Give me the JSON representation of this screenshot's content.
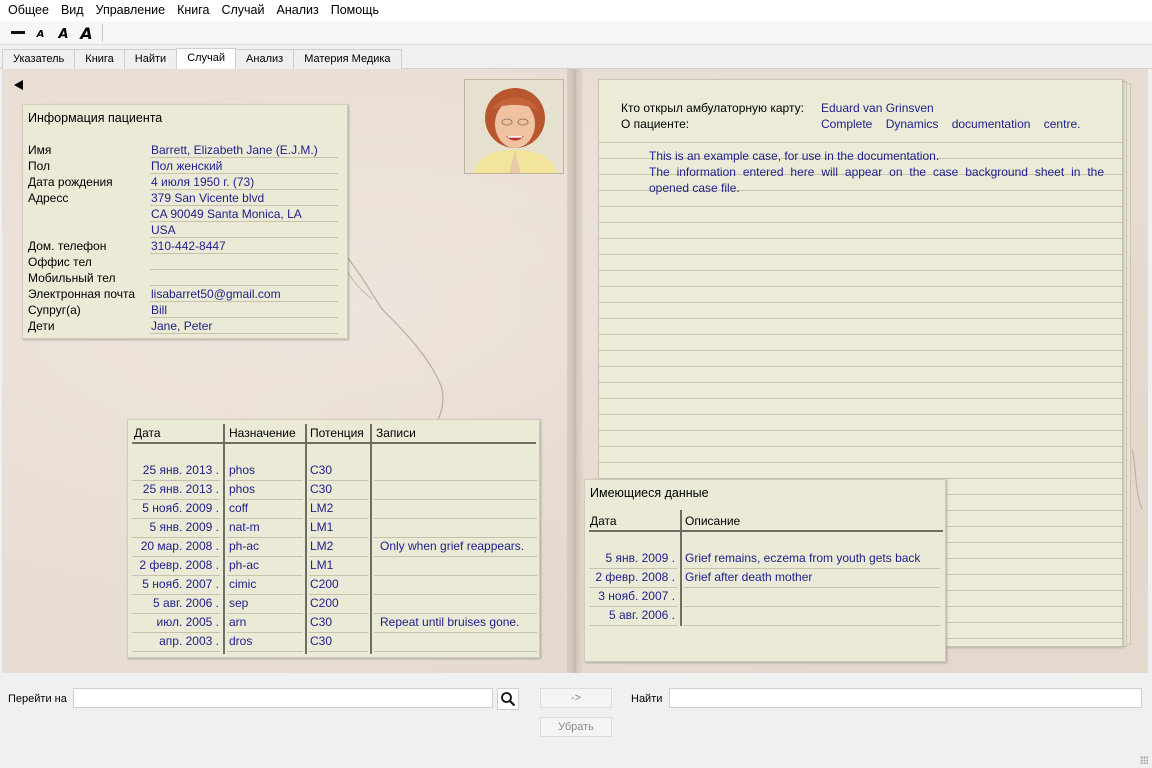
{
  "menu": [
    "Общее",
    "Вид",
    "Управление",
    "Книга",
    "Случай",
    "Анализ",
    "Помощь"
  ],
  "toolbar": {
    "font_sizes": [
      "A",
      "A",
      "A"
    ]
  },
  "tabs": [
    {
      "label": "Указатель",
      "active": false
    },
    {
      "label": "Книга",
      "active": false
    },
    {
      "label": "Найти",
      "active": false
    },
    {
      "label": "Случай",
      "active": true
    },
    {
      "label": "Анализ",
      "active": false
    },
    {
      "label": "Материя Медика",
      "active": false
    }
  ],
  "patient": {
    "title": "Информация пациента",
    "fields": [
      {
        "label": "Имя",
        "value": "Barrett, Elizabeth Jane (E.J.M.)"
      },
      {
        "label": "Пол",
        "value": "Пол женский"
      },
      {
        "label": "Дата рождения",
        "value": "4 июля 1950 г. (73)"
      },
      {
        "label": "Адресс",
        "value": "379 San Vicente blvd"
      },
      {
        "label": "",
        "value": "CA 90049  Santa Monica, LA"
      },
      {
        "label": "",
        "value": "USA"
      },
      {
        "label": "Дом. телефон",
        "value": "310-442-8447"
      },
      {
        "label": "Оффис тел",
        "value": ""
      },
      {
        "label": "Мобильный тел",
        "value": ""
      },
      {
        "label": "Электронная почта",
        "value": "lisabarret50@gmail.com"
      },
      {
        "label": "Супруг(а)",
        "value": "Bill"
      },
      {
        "label": "Дети",
        "value": "Jane, Peter"
      }
    ]
  },
  "prescriptions": {
    "headers": {
      "date": "Дата",
      "remedy": "Назначение",
      "potency": "Потенция",
      "notes": "Записи"
    },
    "rows": [
      {
        "date": "25 янв. 2013 .",
        "remedy": "phos",
        "potency": "C30",
        "notes": ""
      },
      {
        "date": "25 янв. 2013 .",
        "remedy": "phos",
        "potency": "C30",
        "notes": ""
      },
      {
        "date": "5 нояб. 2009 .",
        "remedy": "coff",
        "potency": "LM2",
        "notes": ""
      },
      {
        "date": "5 янв. 2009 .",
        "remedy": "nat-m",
        "potency": "LM1",
        "notes": ""
      },
      {
        "date": "20 мар. 2008 .",
        "remedy": "ph-ac",
        "potency": "LM2",
        "notes": "Only when grief reappears."
      },
      {
        "date": "2 февр. 2008 .",
        "remedy": "ph-ac",
        "potency": "LM1",
        "notes": ""
      },
      {
        "date": "5 нояб. 2007 .",
        "remedy": "cimic",
        "potency": "C200",
        "notes": ""
      },
      {
        "date": "5 авг. 2006 .",
        "remedy": "sep",
        "potency": "C200",
        "notes": ""
      },
      {
        "date": "июл. 2005 .",
        "remedy": "arn",
        "potency": "C30",
        "notes": "Repeat until bruises gone."
      },
      {
        "date": "апр. 2003 .",
        "remedy": "dros",
        "potency": "C30",
        "notes": ""
      }
    ]
  },
  "casebook": {
    "opened_by_label": "Кто открыл амбулаторную карту:",
    "opened_by_value": "Eduard van Grinsven",
    "about_label": "О пациенте:",
    "about_value": "Complete    Dynamics    documentation    centre.",
    "text": "This is an example case, for use in the documentation.\nThe information entered here will appear on the case background sheet in the opened case file."
  },
  "available_data": {
    "title": "Имеющиеся данные",
    "headers": {
      "date": "Дата",
      "description": "Описание"
    },
    "rows": [
      {
        "date": "5 янв. 2009 .",
        "description": "Grief remains, eczema from youth gets back"
      },
      {
        "date": "2 февр. 2008 .",
        "description": "Grief after death mother"
      },
      {
        "date": "3 нояб. 2007 .",
        "description": ""
      },
      {
        "date": "5 авг. 2006 .",
        "description": ""
      }
    ]
  },
  "bottom": {
    "goto_label": "Перейти на",
    "goto_value": "",
    "arrow_button": "->",
    "find_label": "Найти",
    "find_value": "",
    "clear_button": "Убрать"
  }
}
